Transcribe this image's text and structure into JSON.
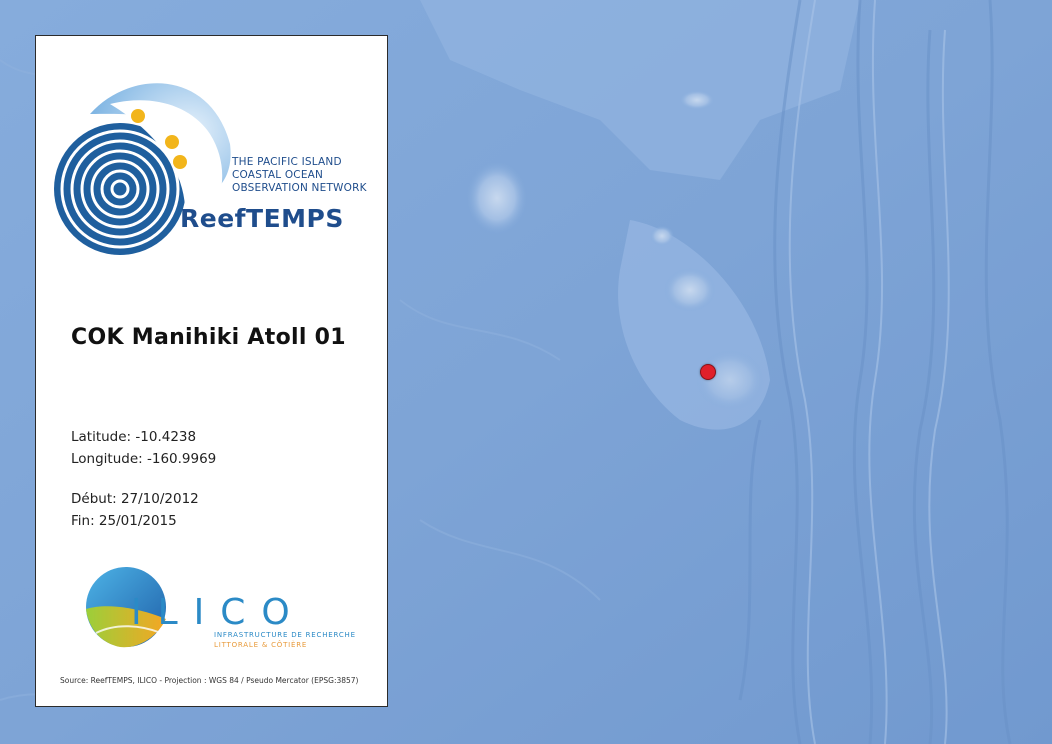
{
  "map": {
    "basemap": "ocean-bathymetry",
    "water_color": "#7fa6d8",
    "marker": {
      "name": "COK Manihiki Atoll 01",
      "latitude": -10.4238,
      "longitude": -160.9969,
      "color": "#e0202a"
    }
  },
  "panel": {
    "logo": {
      "line1": "THE PACIFIC ISLAND",
      "line2": "COASTAL OCEAN",
      "line3": "OBSERVATION NETWORK",
      "brand": "ReefTEMPS",
      "icon": "fingerprint-wave-logo-icon"
    },
    "site_title": "COK Manihiki Atoll 01",
    "latitude_text": "Latitude: -10.4238",
    "longitude_text": "Longitude: -160.9969",
    "start_text": "Début: 27/10/2012",
    "end_text": "Fin: 25/01/2015",
    "partner_logo": {
      "word": "ILICO",
      "sub1": "INFRASTRUCTURE DE RECHERCHE",
      "sub2": "LITTORALE & CÔTIÈRE",
      "icon": "ilico-sphere-icon"
    },
    "source_text": "Source: ReefTEMPS, ILICO - Projection : WGS 84 / Pseudo Mercator (EPSG:3857)"
  }
}
